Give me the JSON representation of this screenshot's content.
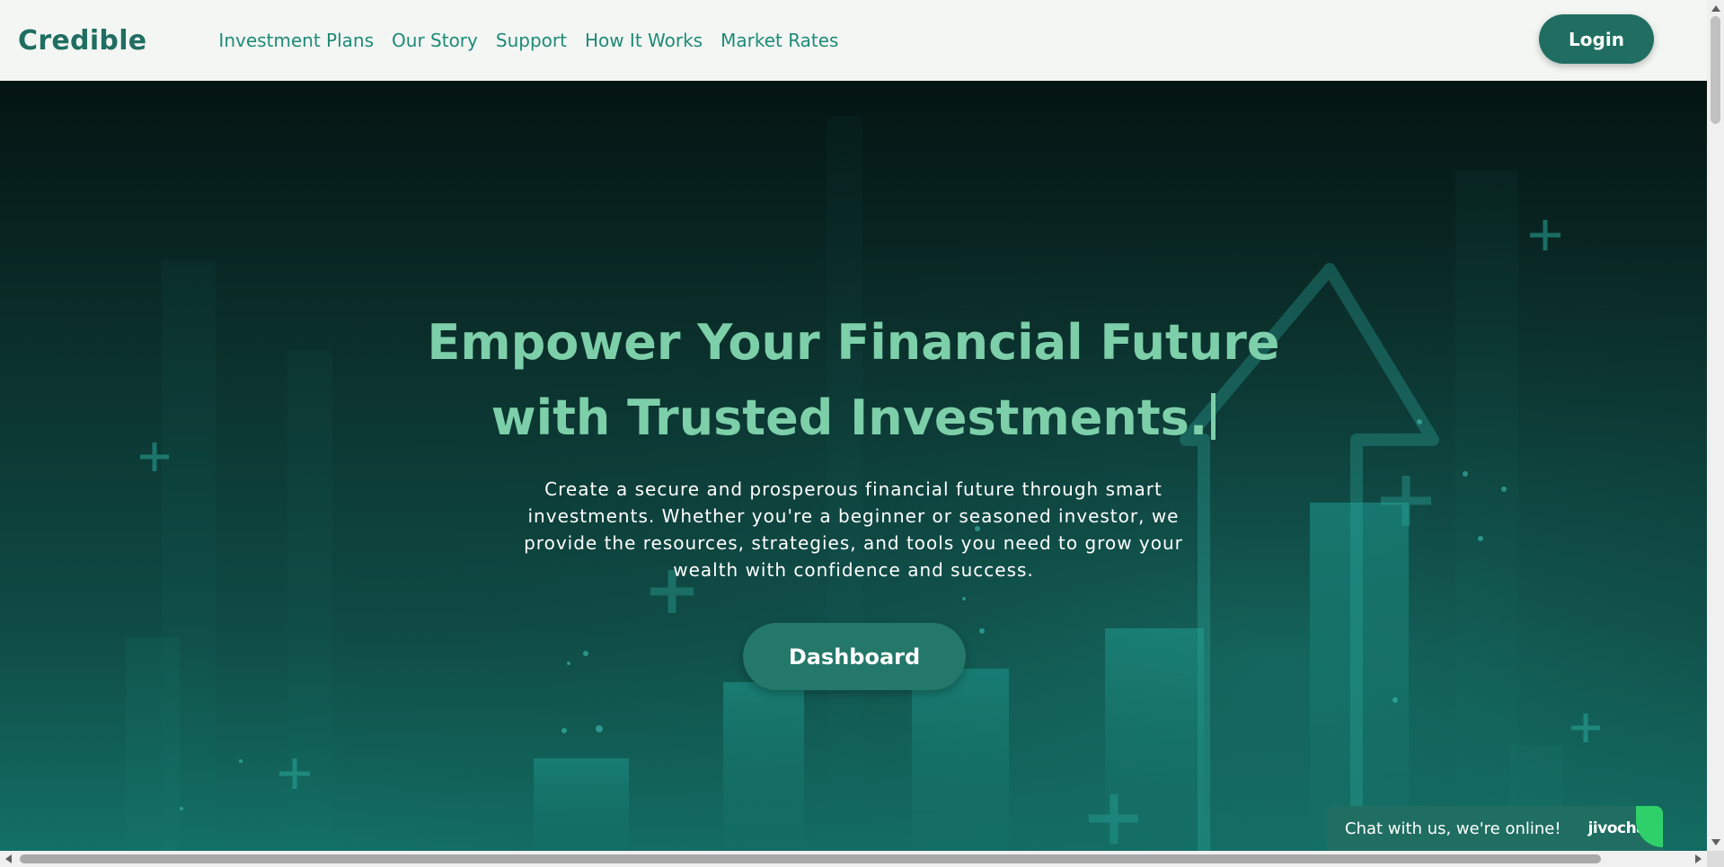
{
  "brand": {
    "logo": "Credible"
  },
  "nav": {
    "items": [
      {
        "label": "Investment Plans"
      },
      {
        "label": "Our Story"
      },
      {
        "label": "Support"
      },
      {
        "label": "How It Works"
      },
      {
        "label": "Market Rates"
      }
    ],
    "login_label": "Login"
  },
  "hero": {
    "title_line1": "Empower Your Financial Future",
    "title_line2": "with Trusted Investments.",
    "subtitle": "Create a secure and prosperous financial future through smart investments. Whether you're a beginner or seasoned investor, we provide the resources, strategies, and tools you need to grow your wealth with confidence and success.",
    "cta_label": "Dashboard"
  },
  "chat": {
    "message": "Chat with us, we're online!",
    "brand": "jivochat"
  },
  "colors": {
    "accent": "#1f6e61",
    "title": "#7dcfa9",
    "nav_link": "#1f8a78",
    "header_bg": "#f3f6f3",
    "chat_indicator": "#2fd06a"
  },
  "icons": {
    "background_art": "growth-arrow-bars-icon",
    "decor": "plus-sparkle-icon"
  }
}
